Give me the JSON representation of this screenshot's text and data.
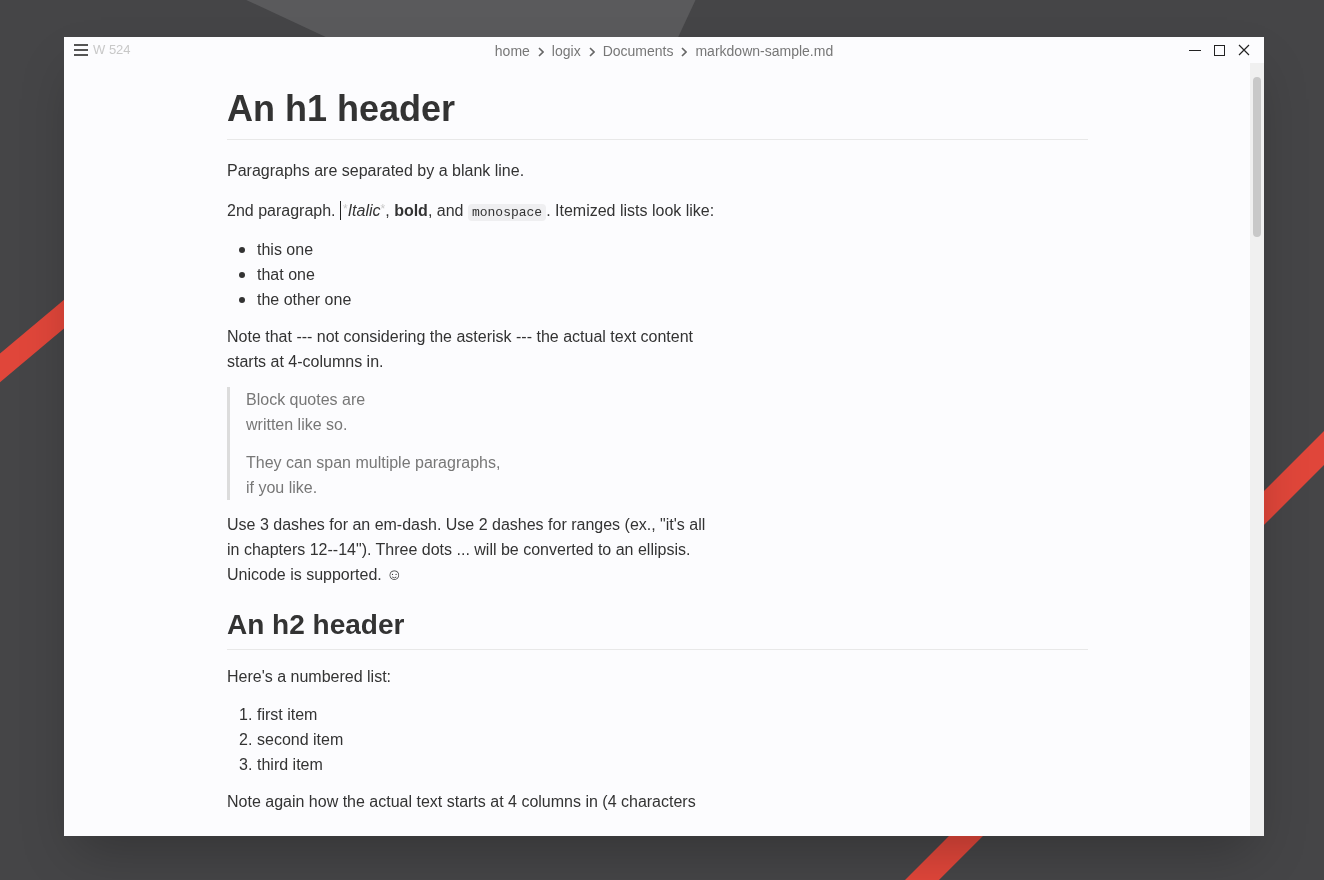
{
  "window": {
    "word_count": "W 524",
    "breadcrumb": [
      "home",
      "logix",
      "Documents",
      "markdown-sample.md"
    ]
  },
  "document": [
    {
      "kind": "h1",
      "text": "An h1 header"
    },
    {
      "kind": "p",
      "text": "Paragraphs are separated by a blank line."
    },
    {
      "kind": "rich",
      "segments": [
        {
          "kind": "text",
          "text": "2nd paragraph. "
        },
        {
          "kind": "cursor"
        },
        {
          "kind": "marker",
          "text": "*"
        },
        {
          "kind": "italic",
          "text": "Italic"
        },
        {
          "kind": "marker",
          "text": "*"
        },
        {
          "kind": "text",
          "text": ", "
        },
        {
          "kind": "bold",
          "text": "bold"
        },
        {
          "kind": "text",
          "text": ", and "
        },
        {
          "kind": "code",
          "text": "monospace"
        },
        {
          "kind": "text",
          "text": ". Itemized lists look like:"
        }
      ]
    },
    {
      "kind": "ul",
      "items": [
        "this one",
        "that one",
        "the other one"
      ]
    },
    {
      "kind": "p",
      "text": "Note that --- not considering the asterisk --- the actual text content starts at 4-columns in."
    },
    {
      "kind": "quote",
      "paragraphs": [
        "Block quotes are\nwritten like so.",
        "They can span multiple paragraphs,\nif you like."
      ]
    },
    {
      "kind": "p",
      "text": "Use 3 dashes for an em-dash. Use 2 dashes for ranges (ex., \"it's all in chapters 12--14\"). Three dots ... will be converted to an ellipsis. Unicode is supported. ☺"
    },
    {
      "kind": "h2",
      "text": "An h2 header"
    },
    {
      "kind": "p",
      "text": "Here's a numbered list:"
    },
    {
      "kind": "ol",
      "items": [
        {
          "number": "1.",
          "text": "first item"
        },
        {
          "number": "2.",
          "text": "second item"
        },
        {
          "number": "3.",
          "text": "third item"
        }
      ]
    },
    {
      "kind": "p",
      "text": "Note again how the actual text starts at 4 columns in (4 characters"
    }
  ]
}
